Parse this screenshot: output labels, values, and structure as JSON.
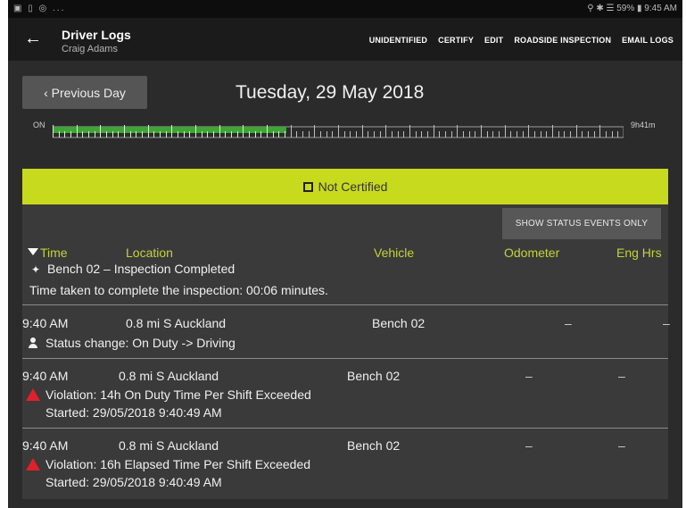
{
  "status_bar": {
    "left_icons": "▣ ▯ ◎ ...",
    "right_text": "⚲ ✱ ☰ 59% ▮ 9:45 AM"
  },
  "app_bar": {
    "title": "Driver Logs",
    "subtitle": "Craig Adams",
    "actions": [
      "UNIDENTIFIED",
      "CERTIFY",
      "EDIT",
      "ROADSIDE INSPECTION",
      "EMAIL LOGS"
    ]
  },
  "date_nav": {
    "previous_label": "‹ Previous Day",
    "date_title": "Tuesday, 29 May 2018"
  },
  "timeline": {
    "start_label": "ON",
    "end_label": "9h41m",
    "on_duty_fraction": 0.41,
    "on_color": "#3fa535",
    "off_color": "#9b9b9b"
  },
  "certification": {
    "status_label": "Not Certified",
    "bar_color": "#c8da1e"
  },
  "list": {
    "show_status_button": "SHOW STATUS EVENTS ONLY",
    "headers": {
      "time": "Time",
      "location": "Location",
      "vehicle": "Vehicle",
      "odometer": "Odometer",
      "eng_hrs": "Eng Hrs"
    },
    "inspection": {
      "title": "Bench 02 – Inspection Completed",
      "detail": "Time taken to complete the inspection: 00:06 minutes."
    },
    "rows": [
      {
        "time": "9:40 AM",
        "location": "0.8 mi S Auckland",
        "vehicle": "Bench 02",
        "odometer": "–",
        "eng_hrs": "–",
        "event": "Status change: On Duty -> Driving",
        "icon": "person-icon"
      },
      {
        "time": "9:40 AM",
        "location": "0.8 mi S Auckland",
        "vehicle": "Bench 02",
        "odometer": "–",
        "eng_hrs": "–",
        "event": "Violation: 14h On Duty Time Per Shift Exceeded",
        "started": "Started: 29/05/2018 9:40:49 AM",
        "icon": "warning-icon"
      },
      {
        "time": "9:40 AM",
        "location": "0.8 mi S Auckland",
        "vehicle": "Bench 02",
        "odometer": "–",
        "eng_hrs": "–",
        "event": "Violation: 16h Elapsed Time Per Shift Exceeded",
        "started": "Started: 29/05/2018 9:40:49 AM",
        "icon": "warning-icon"
      }
    ]
  }
}
